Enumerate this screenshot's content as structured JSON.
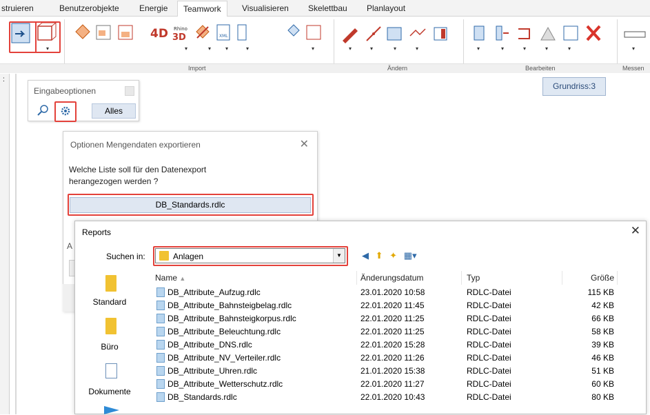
{
  "tabs": [
    "struieren",
    "Benutzerobjekte",
    "Energie",
    "Teamwork",
    "Visualisieren",
    "Skelettbau",
    "Planlayout"
  ],
  "ribbon_groups": [
    "Import",
    "Ändern",
    "Bearbeiten",
    "Messen"
  ],
  "viewport_label": "Grundriss:3",
  "eingabe": {
    "title": "Eingabeoptionen",
    "alles_label": "Alles"
  },
  "export_dialog": {
    "title": "Optionen Mengendaten exportieren",
    "question_line1": "Welche Liste soll für den Datenexport",
    "question_line2": "herangezogen werden ?",
    "button_label": "DB_Standards.rdlc",
    "behind_letter": "A"
  },
  "reports": {
    "title": "Reports",
    "suchen_label": "Suchen in:",
    "folder": "Anlagen",
    "places": [
      "Standard",
      "Büro",
      "Dokumente"
    ],
    "columns": {
      "name": "Name",
      "date": "Änderungsdatum",
      "type": "Typ",
      "size": "Größe"
    },
    "files": [
      {
        "name": "DB_Attribute_Aufzug.rdlc",
        "date": "23.01.2020 10:58",
        "type": "RDLC-Datei",
        "size": "115 KB"
      },
      {
        "name": "DB_Attribute_Bahnsteigbelag.rdlc",
        "date": "22.01.2020 11:45",
        "type": "RDLC-Datei",
        "size": "42 KB"
      },
      {
        "name": "DB_Attribute_Bahnsteigkorpus.rdlc",
        "date": "22.01.2020 11:25",
        "type": "RDLC-Datei",
        "size": "66 KB"
      },
      {
        "name": "DB_Attribute_Beleuchtung.rdlc",
        "date": "22.01.2020 11:25",
        "type": "RDLC-Datei",
        "size": "58 KB"
      },
      {
        "name": "DB_Attribute_DNS.rdlc",
        "date": "22.01.2020 15:28",
        "type": "RDLC-Datei",
        "size": "39 KB"
      },
      {
        "name": "DB_Attribute_NV_Verteiler.rdlc",
        "date": "22.01.2020 11:26",
        "type": "RDLC-Datei",
        "size": "46 KB"
      },
      {
        "name": "DB_Attribute_Uhren.rdlc",
        "date": "21.01.2020 15:38",
        "type": "RDLC-Datei",
        "size": "51 KB"
      },
      {
        "name": "DB_Attribute_Wetterschutz.rdlc",
        "date": "22.01.2020 11:27",
        "type": "RDLC-Datei",
        "size": "60 KB"
      },
      {
        "name": "DB_Standards.rdlc",
        "date": "22.01.2020 10:43",
        "type": "RDLC-Datei",
        "size": "80 KB"
      }
    ]
  },
  "colors": {
    "highlight": "#e3413a",
    "folder": "#f1c232",
    "button": "#dfe7f2"
  }
}
